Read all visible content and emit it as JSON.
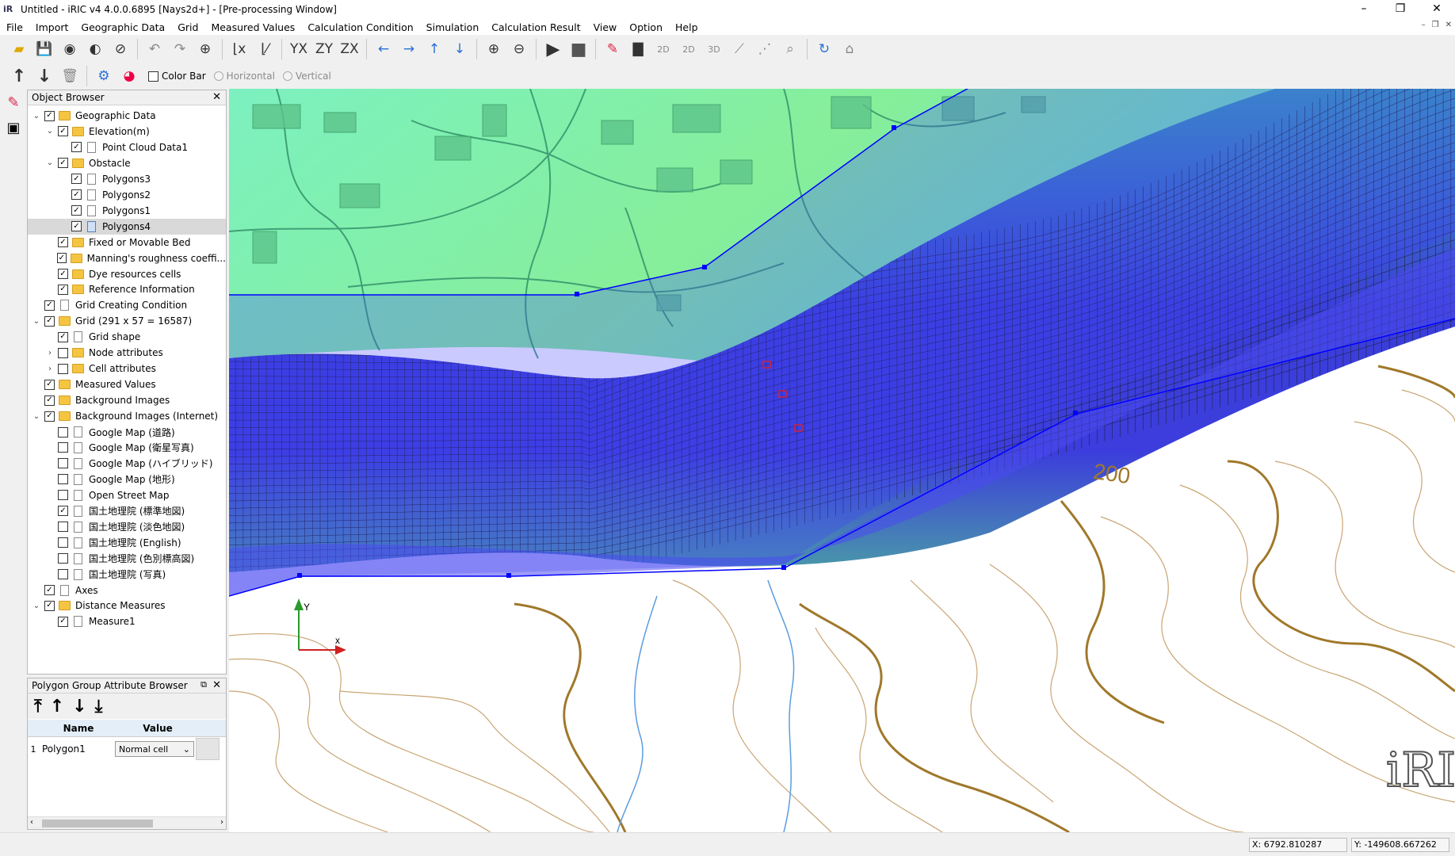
{
  "window": {
    "title": "Untitled - iRIC v4 4.0.0.6895 [Nays2d+] - [Pre-processing Window]",
    "app_icon": "iRIC"
  },
  "menu": [
    "File",
    "Import",
    "Geographic Data",
    "Grid",
    "Measured Values",
    "Calculation Condition",
    "Simulation",
    "Calculation Result",
    "View",
    "Option",
    "Help"
  ],
  "toolbar2": {
    "color_bar_label": "Color Bar",
    "horizontal_label": "Horizontal",
    "vertical_label": "Vertical"
  },
  "object_browser": {
    "title": "Object Browser",
    "items": [
      {
        "label": "Geographic Data",
        "checked": true,
        "type": "folder"
      },
      {
        "label": "Elevation(m)",
        "checked": true,
        "type": "folder"
      },
      {
        "label": "Point Cloud Data1",
        "checked": true,
        "type": "doc"
      },
      {
        "label": "Obstacle",
        "checked": true,
        "type": "folder"
      },
      {
        "label": "Polygons3",
        "checked": true,
        "type": "doc"
      },
      {
        "label": "Polygons2",
        "checked": true,
        "type": "doc"
      },
      {
        "label": "Polygons1",
        "checked": true,
        "type": "doc"
      },
      {
        "label": "Polygons4",
        "checked": true,
        "type": "doc-blue",
        "selected": true
      },
      {
        "label": "Fixed or Movable Bed",
        "checked": true,
        "type": "folder"
      },
      {
        "label": "Manning's roughness coeffi...",
        "checked": true,
        "type": "folder"
      },
      {
        "label": "Dye resources cells",
        "checked": true,
        "type": "folder"
      },
      {
        "label": "Reference Information",
        "checked": true,
        "type": "folder"
      },
      {
        "label": "Grid Creating Condition",
        "checked": true,
        "type": "doc"
      },
      {
        "label": "Grid (291 x 57 = 16587)",
        "checked": true,
        "type": "folder"
      },
      {
        "label": "Grid shape",
        "checked": true,
        "type": "doc"
      },
      {
        "label": "Node attributes",
        "checked": false,
        "type": "folder"
      },
      {
        "label": "Cell attributes",
        "checked": false,
        "type": "folder"
      },
      {
        "label": "Measured Values",
        "checked": true,
        "type": "folder"
      },
      {
        "label": "Background Images",
        "checked": true,
        "type": "folder"
      },
      {
        "label": "Background Images (Internet)",
        "checked": true,
        "type": "folder"
      },
      {
        "label": "Google Map (道路)",
        "checked": false,
        "type": "doc"
      },
      {
        "label": "Google Map (衛星写真)",
        "checked": false,
        "type": "doc"
      },
      {
        "label": "Google Map (ハイブリッド)",
        "checked": false,
        "type": "doc"
      },
      {
        "label": "Google Map (地形)",
        "checked": false,
        "type": "doc"
      },
      {
        "label": "Open Street Map",
        "checked": false,
        "type": "doc"
      },
      {
        "label": "国土地理院 (標準地図)",
        "checked": true,
        "type": "doc"
      },
      {
        "label": "国土地理院 (淡色地図)",
        "checked": false,
        "type": "doc"
      },
      {
        "label": "国土地理院 (English)",
        "checked": false,
        "type": "doc"
      },
      {
        "label": "国土地理院 (色別標高図)",
        "checked": false,
        "type": "doc"
      },
      {
        "label": "国土地理院 (写真)",
        "checked": false,
        "type": "doc"
      },
      {
        "label": "Axes",
        "checked": true,
        "type": "doc"
      },
      {
        "label": "Distance Measures",
        "checked": true,
        "type": "folder"
      },
      {
        "label": "Measure1",
        "checked": true,
        "type": "doc"
      }
    ]
  },
  "polygon_browser": {
    "title": "Polygon Group Attribute Browser",
    "col_name": "Name",
    "col_value": "Value",
    "row_index": "1",
    "row_name": "Polygon1",
    "row_value": "Normal cell"
  },
  "canvas": {
    "contour_label": "200",
    "axis_x": "x",
    "axis_y": "Y",
    "logo": "iRIC"
  },
  "status": {
    "x_readout": "X: 6792.810287",
    "y_readout": "Y: -149608.667262"
  },
  "colors": {
    "grid_line": "#1a1a2a",
    "polygon_outline": "#0000ff",
    "contour": "#a0782a",
    "river": "#3a8ad8"
  }
}
